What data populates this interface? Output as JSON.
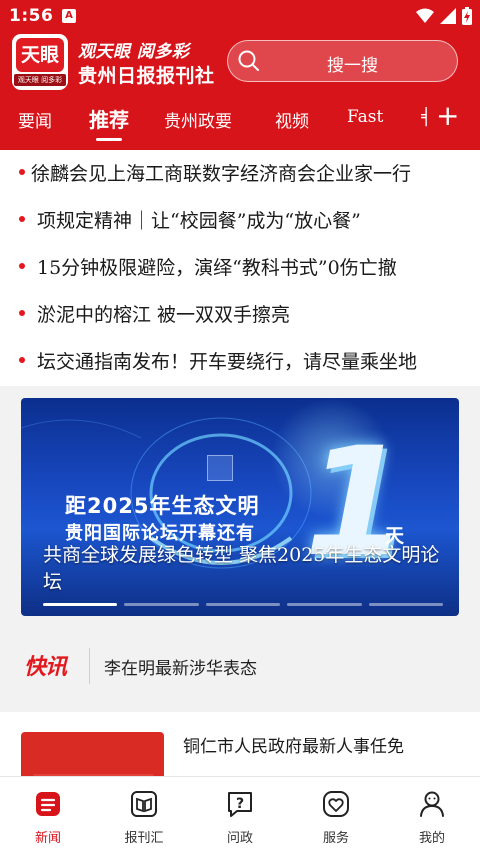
{
  "status_bar": {
    "time": "1:56",
    "notification_icon": "A"
  },
  "header": {
    "logo_text": "天眼",
    "logo_sub": "观天眼 阅多彩",
    "brand_line1": "观天眼 阅多彩",
    "brand_line2": "贵州日报报刊社",
    "search_placeholder": "搜一搜"
  },
  "tabs": [
    {
      "label": "要闻"
    },
    {
      "label": "推荐",
      "active": true
    },
    {
      "label": "贵州政要"
    },
    {
      "label": "视频"
    },
    {
      "label": "Fast"
    },
    {
      "label": "╡"
    }
  ],
  "headlines": [
    "徐麟会见上海工商联数字经济商会企业家一行",
    "项规定精神｜让“校园餐”成为“放心餐”",
    "15分钟极限避险，演绎“教科书式”0伤亡撤",
    " 淤泥中的榕江  被一双双手擦亮",
    "坛交通指南发布！开车要绕行，请尽量乘坐地"
  ],
  "banner": {
    "line1": "距2025年生态文明",
    "line2": "贵阳国际论坛开幕还有",
    "big_number": "1",
    "unit": "天",
    "caption": "共商全球发展绿色转型  聚焦2025年生态文明论坛",
    "slides": 5,
    "active_slide": 1
  },
  "flash": {
    "logo": "快讯",
    "text": "李在明最新涉华表态"
  },
  "article": {
    "title": "铜仁市人民政府最新人事任免"
  },
  "bottom_nav": [
    {
      "label": "新闻",
      "icon": "news-icon",
      "active": true
    },
    {
      "label": "报刊汇",
      "icon": "book-icon"
    },
    {
      "label": "问政",
      "icon": "question-icon"
    },
    {
      "label": "服务",
      "icon": "heart-icon"
    },
    {
      "label": "我的",
      "icon": "user-icon"
    }
  ],
  "colors": {
    "brand_red": "#d8141b",
    "text": "#1a1a1a",
    "banner_blue": "#1848c0"
  }
}
